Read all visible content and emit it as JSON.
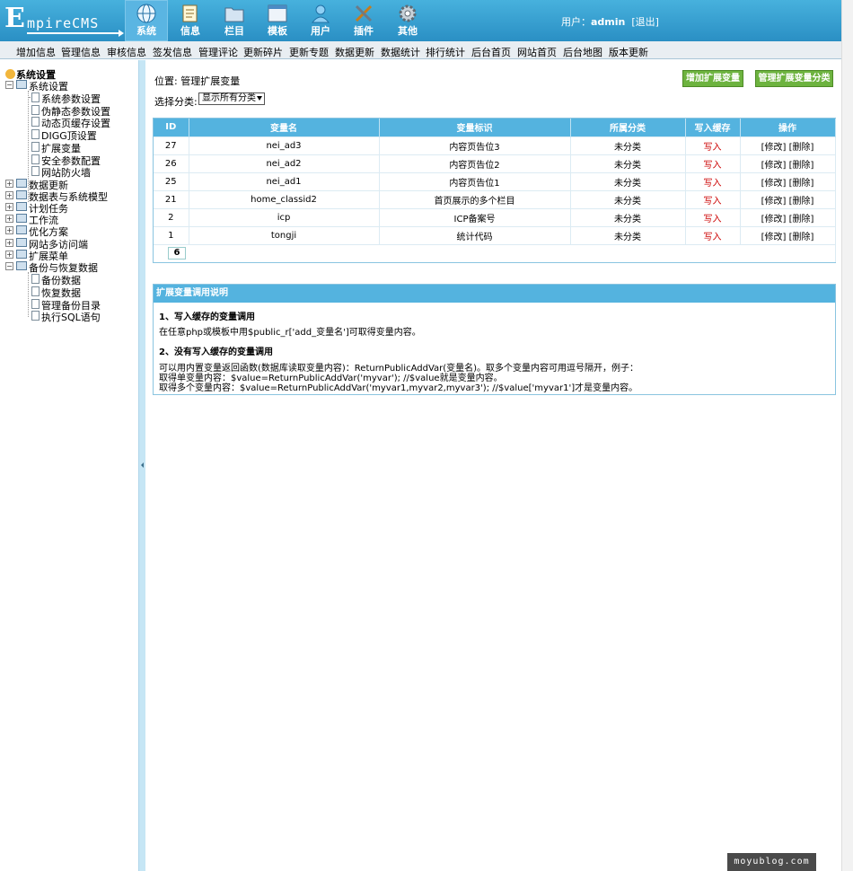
{
  "header": {
    "logo_big": "E",
    "logo_rest": "mpireCMS",
    "tabs": [
      {
        "label": "系统",
        "icon": "globe-icon"
      },
      {
        "label": "信息",
        "icon": "notepad-icon"
      },
      {
        "label": "栏目",
        "icon": "folder-icon"
      },
      {
        "label": "模板",
        "icon": "window-icon"
      },
      {
        "label": "用户",
        "icon": "user-icon"
      },
      {
        "label": "插件",
        "icon": "tools-icon"
      },
      {
        "label": "其他",
        "icon": "gear-icon"
      }
    ],
    "user_prefix": "用户：",
    "username": "admin",
    "logout": "[退出]"
  },
  "menubar": [
    "增加信息",
    "管理信息",
    "审核信息",
    "签发信息",
    "管理评论",
    "更新碎片",
    "更新专题",
    "数据更新",
    "数据统计",
    "排行统计",
    "后台首页",
    "网站首页",
    "后台地图",
    "版本更新"
  ],
  "sidebar": {
    "root": "系统设置",
    "system_settings": "系统设置",
    "system_children": [
      "系统参数设置",
      "伪静态参数设置",
      "动态页缓存设置",
      "DIGG顶设置",
      "扩展变量",
      "安全参数配置",
      "网站防火墙"
    ],
    "groups": [
      "数据更新",
      "数据表与系统模型",
      "计划任务",
      "工作流",
      "优化方案",
      "网站多访问端",
      "扩展菜单"
    ],
    "backup": "备份与恢复数据",
    "backup_children": [
      "备份数据",
      "恢复数据",
      "管理备份目录",
      "执行SQL语句"
    ]
  },
  "main": {
    "location_prefix": "位置: ",
    "location_link": "管理扩展变量",
    "add_button": "增加扩展变量",
    "manage_category_button": "管理扩展变量分类",
    "filter_label": "选择分类:",
    "filter_value": "显示所有分类",
    "table": {
      "headers": [
        "ID",
        "变量名",
        "变量标识",
        "所属分类",
        "写入缓存",
        "操作"
      ],
      "rows": [
        [
          "27",
          "nei_ad3",
          "内容页告位3",
          "未分类",
          "写入",
          "[修改] [删除]"
        ],
        [
          "26",
          "nei_ad2",
          "内容页告位2",
          "未分类",
          "写入",
          "[修改] [删除]"
        ],
        [
          "25",
          "nei_ad1",
          "内容页告位1",
          "未分类",
          "写入",
          "[修改] [删除]"
        ],
        [
          "21",
          "home_classid2",
          "首页展示的多个栏目",
          "未分类",
          "写入",
          "[修改] [删除]"
        ],
        [
          "2",
          "icp",
          "ICP备案号",
          "未分类",
          "写入",
          "[修改] [删除]"
        ],
        [
          "1",
          "tongji",
          "统计代码",
          "未分类",
          "写入",
          "[修改] [删除]"
        ]
      ],
      "page": "6"
    },
    "help": {
      "title": "扩展变量调用说明",
      "h1": "1、写入缓存的变量调用",
      "p1": "在任意php或模板中用$public_r['add_变量名']可取得变量内容。",
      "h2": "2、没有写入缓存的变量调用",
      "p2": "可以用内置变量返回函数(数据库读取变量内容)：ReturnPublicAddVar(变量名)。取多个变量内容可用逗号隔开，例子：",
      "p3": "取得单变量内容：$value=ReturnPublicAddVar('myvar'); //$value就是变量内容。",
      "p4": "取得多个变量内容：$value=ReturnPublicAddVar('myvar1,myvar2,myvar3'); //$value['myvar1']才是变量内容。"
    }
  },
  "watermark": "moyublog.com"
}
